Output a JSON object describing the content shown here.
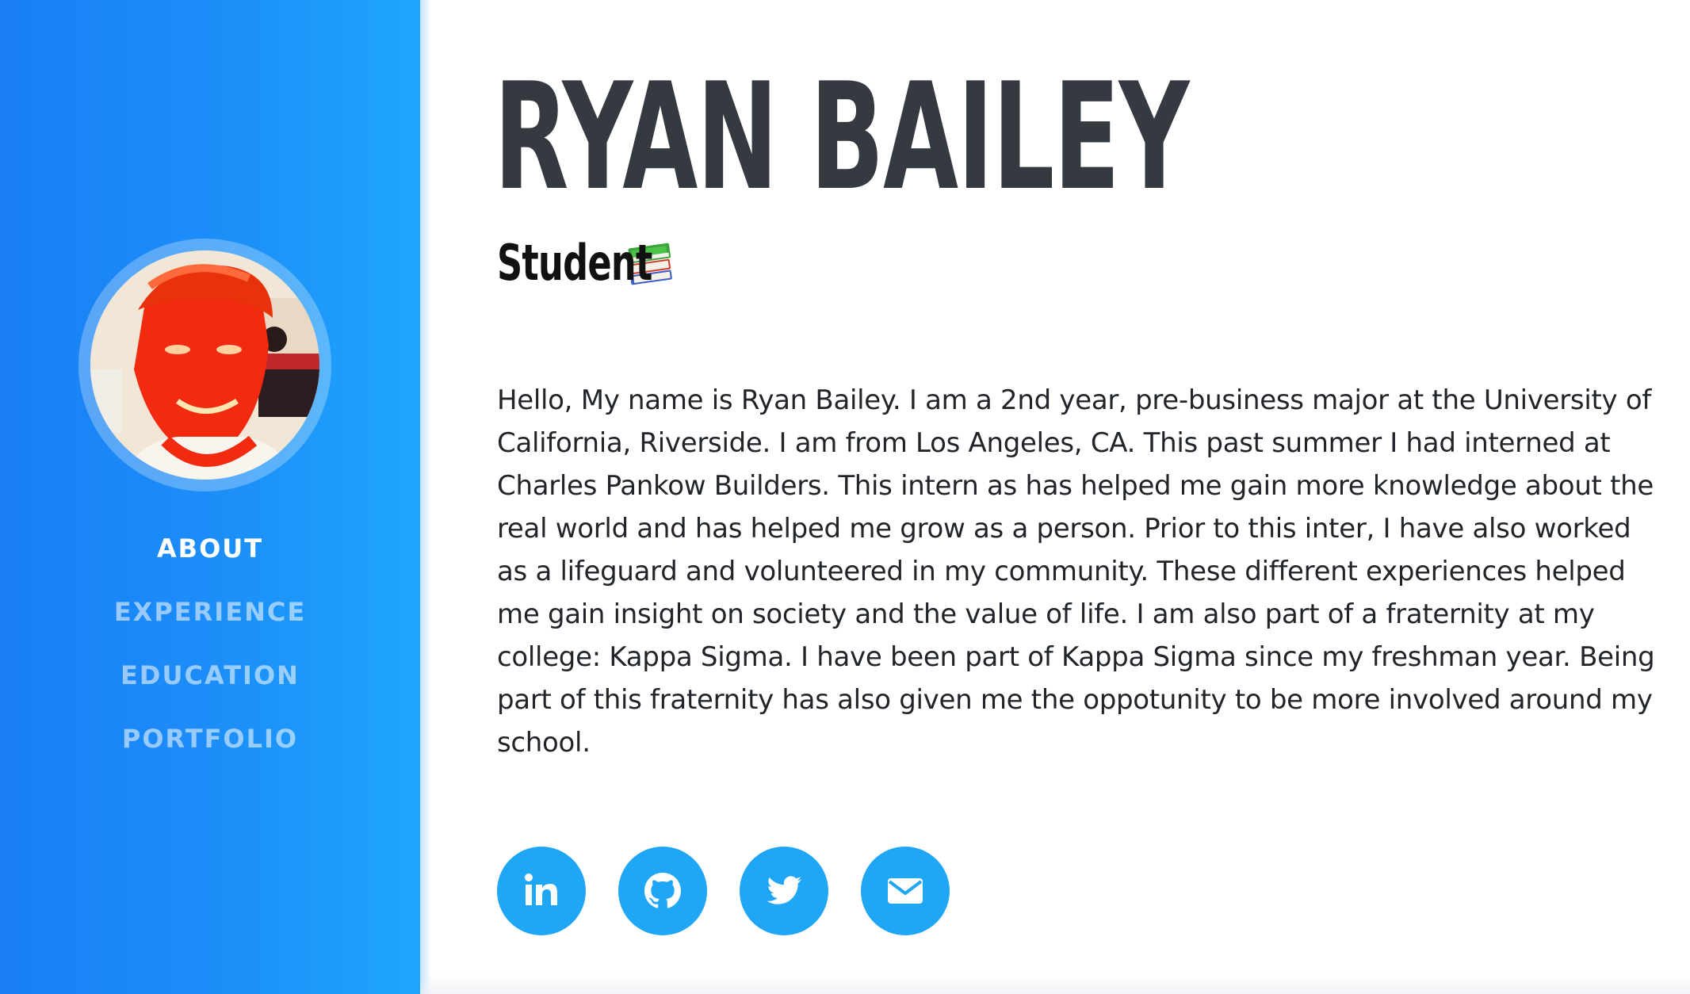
{
  "profile": {
    "name": "RYAN BAILEY",
    "subtitle": "Student",
    "subtitle_icon": "books-icon",
    "avatar_alt": "profile-photo"
  },
  "nav": {
    "items": [
      {
        "label": "ABOUT",
        "active": true
      },
      {
        "label": "EXPERIENCE",
        "active": false
      },
      {
        "label": "EDUCATION",
        "active": false
      },
      {
        "label": "PORTFOLIO",
        "active": false
      }
    ]
  },
  "bio": {
    "text": "Hello, My name is Ryan Bailey. I am a 2nd year, pre-business major at the University of California, Riverside. I am from Los Angeles, CA. This past summer I had interned at Charles Pankow Builders. This intern as has helped me gain more knowledge about the real world and has helped me grow as a person. Prior to this inter, I have also worked as a lifeguard and volunteered in my community. These different experiences helped me gain insight on society and the value of life. I am also part of a fraternity at my college: Kappa Sigma. I have been part of Kappa Sigma since my freshman year. Being part of this fraternity has also given me the oppotunity to be more involved around my school."
  },
  "social": [
    {
      "icon": "linkedin-icon"
    },
    {
      "icon": "github-icon"
    },
    {
      "icon": "twitter-icon"
    },
    {
      "icon": "email-icon"
    }
  ],
  "colors": {
    "sidebar_start": "#1a7ef5",
    "sidebar_end": "#1fa6fc",
    "accent": "#1fa6f5",
    "heading": "#343a40",
    "text": "#212529"
  }
}
